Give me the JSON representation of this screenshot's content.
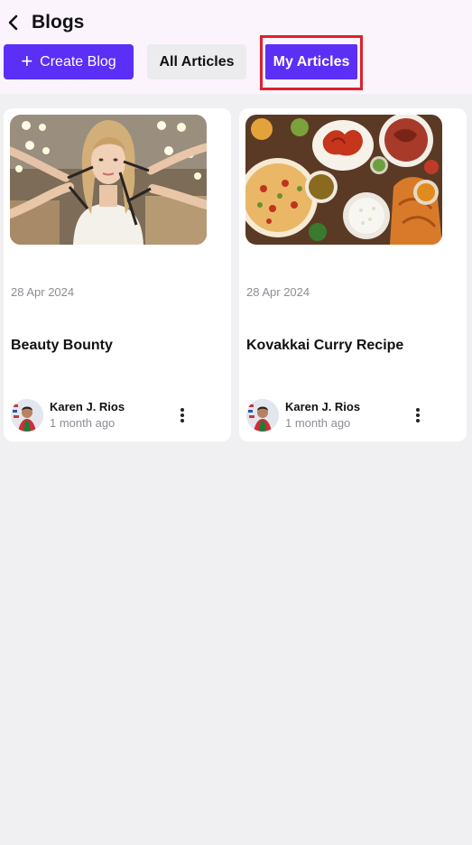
{
  "header": {
    "title": "Blogs",
    "create_label": "Create Blog",
    "tabs": [
      {
        "label": "All Articles",
        "active": false
      },
      {
        "label": "My Articles",
        "active": true
      }
    ]
  },
  "posts": [
    {
      "date": "28 Apr 2024",
      "title": "Beauty Bounty",
      "author": "Karen J. Rios",
      "ago": "1 month ago",
      "image": "makeup-photo"
    },
    {
      "date": "28 Apr 2024",
      "title": "Kovakkai Curry Recipe",
      "author": "Karen J. Rios",
      "ago": "1 month ago",
      "image": "food-spread-photo"
    }
  ],
  "colors": {
    "accent": "#5b2ff5",
    "highlight": "#e0202e",
    "header_bg": "#fbf4fd",
    "page_bg": "#f0eff2"
  }
}
